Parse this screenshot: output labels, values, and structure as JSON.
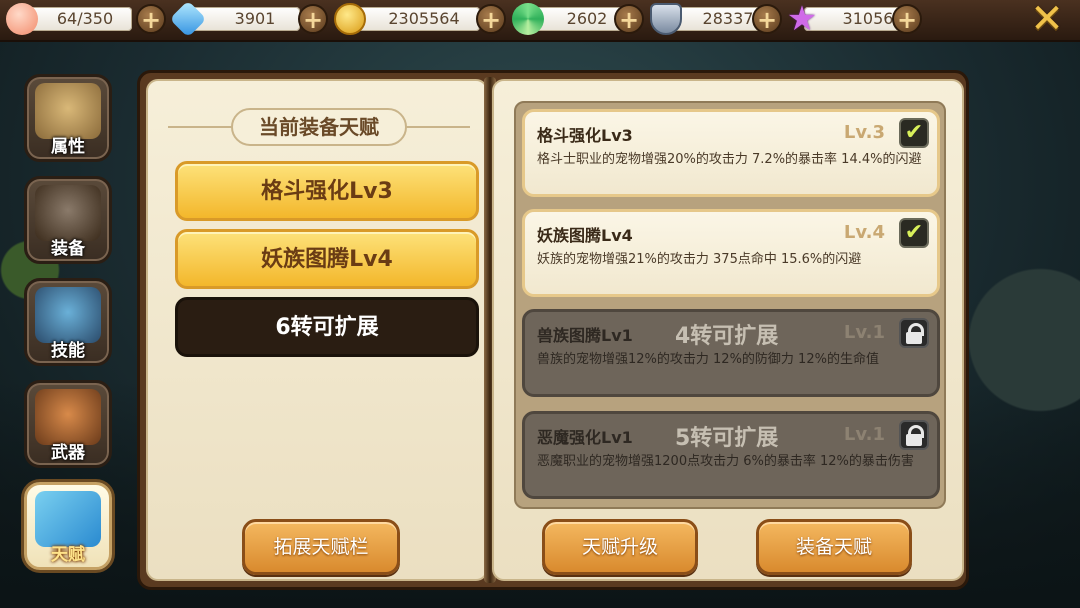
{
  "resources": [
    {
      "name": "pet-food",
      "icon": "peach-icon",
      "value": "64/350",
      "color": "#f5a58a"
    },
    {
      "name": "diamond",
      "icon": "diamond-icon",
      "value": "3901",
      "color": "#5fb7f0"
    },
    {
      "name": "gold",
      "icon": "coin-icon",
      "value": "2305564",
      "color": "#f2c12e"
    },
    {
      "name": "candy",
      "icon": "lollipop-icon",
      "value": "2602",
      "color": "#5ad07a"
    },
    {
      "name": "honor",
      "icon": "shield-badge-icon",
      "value": "28337",
      "color": "#8a9bb0"
    },
    {
      "name": "star",
      "icon": "purple-star-icon",
      "value": "31056",
      "color": "#c05ad8"
    }
  ],
  "tabs": [
    {
      "label": "属性",
      "icon": "scroll-icon"
    },
    {
      "label": "装备",
      "icon": "helmet-icon"
    },
    {
      "label": "技能",
      "icon": "skill-book-icon"
    },
    {
      "label": "武器",
      "icon": "quiver-icon"
    },
    {
      "label": "天赋",
      "icon": "talent-chart-icon",
      "active": true
    }
  ],
  "left_page": {
    "heading": "当前装备天赋",
    "slots": [
      {
        "label": "格斗强化Lv3",
        "state": "equipped"
      },
      {
        "label": "妖族图腾Lv4",
        "state": "equipped"
      },
      {
        "label": "6转可扩展",
        "state": "locked"
      }
    ],
    "expand_button": "拓展天赋栏"
  },
  "right_page": {
    "talents": [
      {
        "name": "格斗强化Lv3",
        "level": "Lv.3",
        "desc": "格斗士职业的宠物增强20%的攻击力 7.2%的暴击率 14.4%的闪避",
        "status": "checked"
      },
      {
        "name": "妖族图腾Lv4",
        "level": "Lv.4",
        "desc": "妖族的宠物增强21%的攻击力 375点命中 15.6%的闪避",
        "status": "checked"
      },
      {
        "name": "兽族图腾Lv1",
        "level": "Lv.1",
        "desc": "兽族的宠物增强12%的攻击力 12%的防御力 12%的生命值",
        "status": "locked",
        "hint": "4转可扩展"
      },
      {
        "name": "恶魔强化Lv1",
        "level": "Lv.1",
        "desc": "恶魔职业的宠物增强1200点攻击力 6%的暴击率 12%的暴击伤害",
        "status": "locked",
        "hint": "5转可扩展"
      }
    ],
    "upgrade_button": "天赋升级",
    "equip_button": "装备天赋"
  },
  "close_icon": "close-x-icon",
  "check_glyph": "✔",
  "plus_glyph": "+",
  "close_glyph": "✕"
}
